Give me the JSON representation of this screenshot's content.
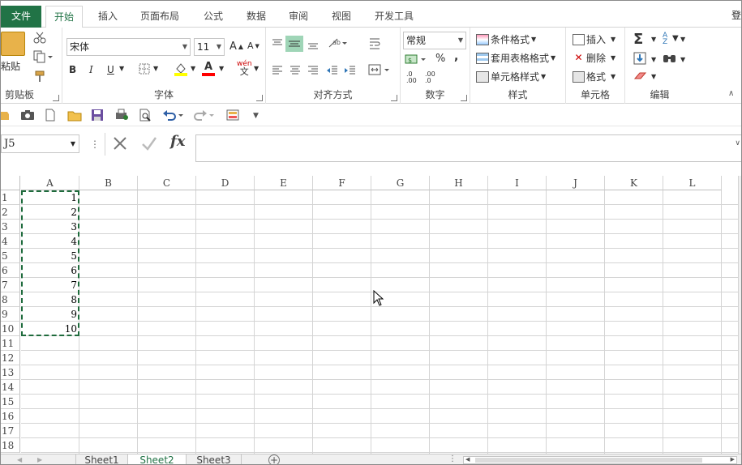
{
  "tabs": {
    "file": "文件",
    "items": [
      "开始",
      "插入",
      "页面布局",
      "公式",
      "数据",
      "审阅",
      "视图",
      "开发工具"
    ],
    "login": "登"
  },
  "ribbon": {
    "clipboard": {
      "paste": "粘贴",
      "label": "剪贴板"
    },
    "font": {
      "name": "宋体",
      "size": "11",
      "label": "字体",
      "bold": "B",
      "italic": "I",
      "underline": "U",
      "phonetic_top": "wén",
      "phonetic_bottom": "文"
    },
    "alignment": {
      "label": "对齐方式"
    },
    "number": {
      "format": "常规",
      "percent": "%",
      "comma": ",",
      "inc_decimal": ".0 .00",
      "dec_decimal": ".00 .0",
      "label": "数字"
    },
    "styles": {
      "conditional": "条件格式",
      "table": "套用表格格式",
      "cell": "单元格样式",
      "label": "样式"
    },
    "cells": {
      "insert": "插入",
      "delete": "删除",
      "format": "格式",
      "label": "单元格"
    },
    "editing": {
      "sum": "Σ",
      "label": "编辑"
    }
  },
  "formula_bar": {
    "name_box": "J5",
    "fx": "fx",
    "value": ""
  },
  "grid": {
    "columns": [
      "A",
      "B",
      "C",
      "D",
      "E",
      "F",
      "G",
      "H",
      "I",
      "J",
      "K",
      "L"
    ],
    "rows": [
      "1",
      "2",
      "3",
      "4",
      "5",
      "6",
      "7",
      "8",
      "9",
      "10",
      "11",
      "12",
      "13",
      "14",
      "15",
      "16",
      "17",
      "18"
    ],
    "column_a_values": [
      "1",
      "2",
      "3",
      "4",
      "5",
      "6",
      "7",
      "8",
      "9",
      "10"
    ]
  },
  "sheets": {
    "items": [
      "Sheet1",
      "Sheet2",
      "Sheet3"
    ],
    "active": "Sheet2"
  },
  "colors": {
    "accent": "#217346",
    "copy_border": "#1e6b3c",
    "gridline": "#d4d4d4"
  }
}
